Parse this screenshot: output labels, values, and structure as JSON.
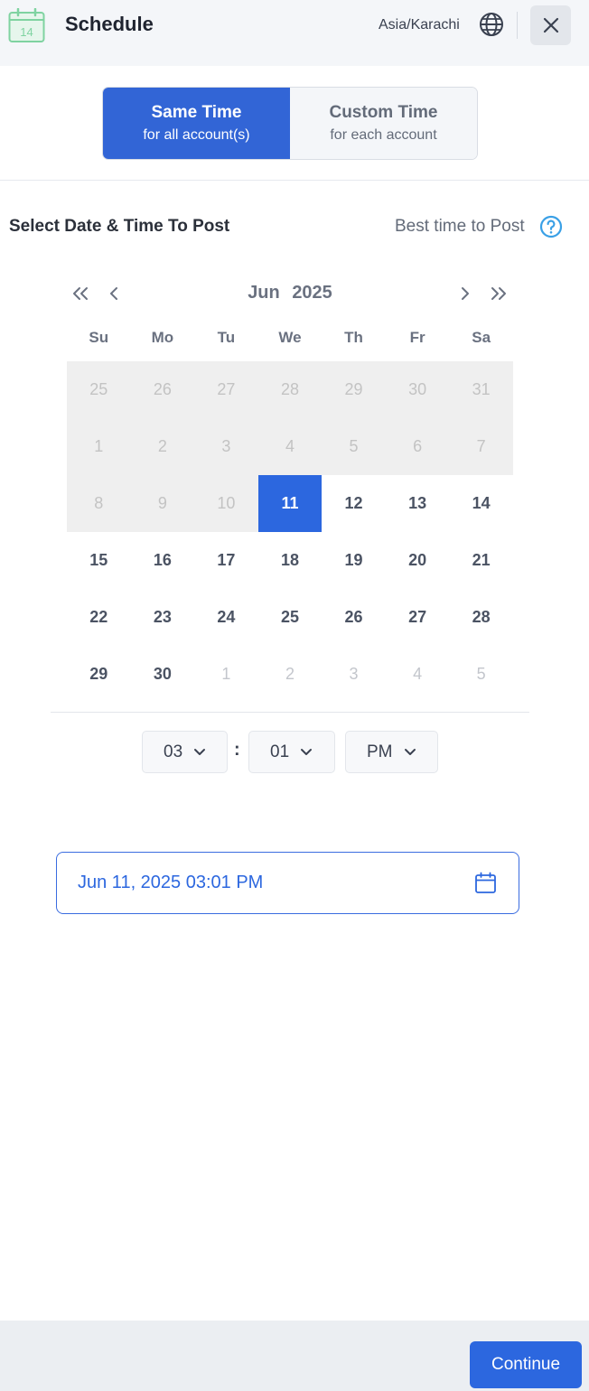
{
  "header": {
    "title": "Schedule",
    "calendar_icon_text": "14",
    "timezone": "Asia/Karachi",
    "globe_icon": "globe-icon",
    "close_icon": "close-icon"
  },
  "mode_toggle": {
    "options": [
      {
        "label": "Same Time",
        "sublabel": "for all account(s)",
        "active": true
      },
      {
        "label": "Custom Time",
        "sublabel": "for each account",
        "active": false
      }
    ]
  },
  "section": {
    "title": "Select Date & Time To Post",
    "best_time_label": "Best time to Post",
    "help_icon": "question-circle-icon"
  },
  "calendar": {
    "month": "Jun",
    "year": "2025",
    "nav_icons": [
      "double-chevron-left-icon",
      "chevron-left-icon",
      "chevron-right-icon",
      "double-chevron-right-icon"
    ],
    "weekdays": [
      "Su",
      "Mo",
      "Tu",
      "We",
      "Th",
      "Fr",
      "Sa"
    ],
    "days": [
      {
        "d": "25",
        "s": "disabled"
      },
      {
        "d": "26",
        "s": "disabled"
      },
      {
        "d": "27",
        "s": "disabled"
      },
      {
        "d": "28",
        "s": "disabled"
      },
      {
        "d": "29",
        "s": "disabled"
      },
      {
        "d": "30",
        "s": "disabled"
      },
      {
        "d": "31",
        "s": "disabled"
      },
      {
        "d": "1",
        "s": "disabled"
      },
      {
        "d": "2",
        "s": "disabled"
      },
      {
        "d": "3",
        "s": "disabled"
      },
      {
        "d": "4",
        "s": "disabled"
      },
      {
        "d": "5",
        "s": "disabled"
      },
      {
        "d": "6",
        "s": "disabled"
      },
      {
        "d": "7",
        "s": "disabled"
      },
      {
        "d": "8",
        "s": "disabled"
      },
      {
        "d": "9",
        "s": "disabled"
      },
      {
        "d": "10",
        "s": "disabled"
      },
      {
        "d": "11",
        "s": "selected"
      },
      {
        "d": "12",
        "s": "normal"
      },
      {
        "d": "13",
        "s": "normal"
      },
      {
        "d": "14",
        "s": "normal"
      },
      {
        "d": "15",
        "s": "normal"
      },
      {
        "d": "16",
        "s": "normal"
      },
      {
        "d": "17",
        "s": "normal"
      },
      {
        "d": "18",
        "s": "normal"
      },
      {
        "d": "19",
        "s": "normal"
      },
      {
        "d": "20",
        "s": "normal"
      },
      {
        "d": "21",
        "s": "normal"
      },
      {
        "d": "22",
        "s": "normal"
      },
      {
        "d": "23",
        "s": "normal"
      },
      {
        "d": "24",
        "s": "normal"
      },
      {
        "d": "25",
        "s": "normal"
      },
      {
        "d": "26",
        "s": "normal"
      },
      {
        "d": "27",
        "s": "normal"
      },
      {
        "d": "28",
        "s": "normal"
      },
      {
        "d": "29",
        "s": "normal"
      },
      {
        "d": "30",
        "s": "normal"
      },
      {
        "d": "1",
        "s": "other"
      },
      {
        "d": "2",
        "s": "other"
      },
      {
        "d": "3",
        "s": "other"
      },
      {
        "d": "4",
        "s": "other"
      },
      {
        "d": "5",
        "s": "other"
      }
    ]
  },
  "time": {
    "hour": "03",
    "minute": "01",
    "separator": ":",
    "period": "PM"
  },
  "selected_datetime": {
    "value": "Jun 11, 2025 03:01 PM",
    "icon": "calendar-icon"
  },
  "footer": {
    "continue_label": "Continue"
  },
  "colors": {
    "accent": "#2c67df",
    "toggle_active": "#3265d6",
    "disabled_cell": "#efefef",
    "header_bg": "#f4f6f9",
    "footer_bg": "#ebeef2",
    "calendar_icon_green": "#7fd3a1"
  }
}
